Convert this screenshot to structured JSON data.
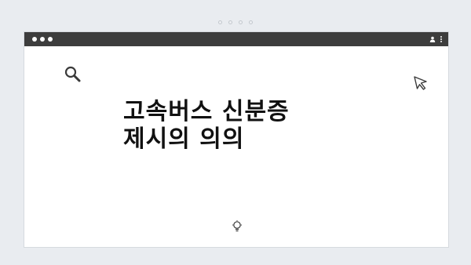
{
  "pager": {
    "count": 4
  },
  "window": {
    "titlebar": {
      "traffic_lights": 3,
      "icons": [
        "avatar-icon",
        "kebab-menu-icon"
      ]
    },
    "content": {
      "headline_line1": "고속버스 신분증",
      "headline_line2": "제시의 의의",
      "icons": [
        "search-icon",
        "cursor-icon",
        "lightbulb-icon"
      ]
    }
  },
  "colors": {
    "background": "#e9ecf0",
    "titlebar": "#3d3d3d",
    "window": "#ffffff",
    "text": "#111111"
  }
}
